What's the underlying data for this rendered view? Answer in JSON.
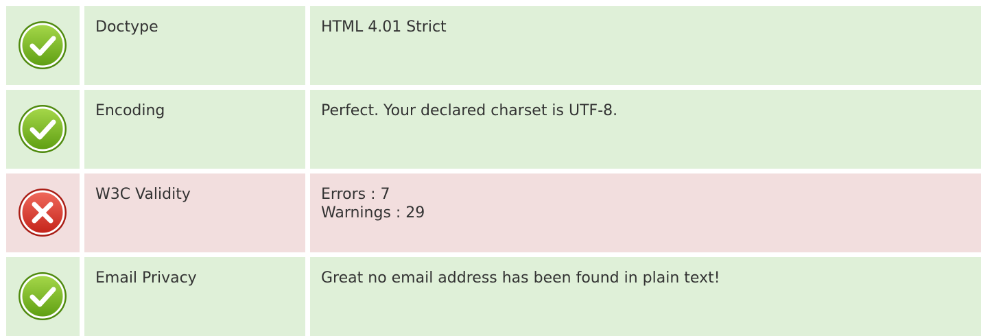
{
  "colors": {
    "pass_bg": "#dff0d8",
    "fail_bg": "#f2dede",
    "pass_icon": "#7ab51d",
    "fail_icon": "#d9342b"
  },
  "rows": [
    {
      "status": "pass",
      "icon": "check-icon",
      "label": "Doctype",
      "value": [
        "HTML 4.01 Strict"
      ]
    },
    {
      "status": "pass",
      "icon": "check-icon",
      "label": "Encoding",
      "value": [
        "Perfect. Your declared charset is UTF-8."
      ]
    },
    {
      "status": "fail",
      "icon": "cross-icon",
      "label": "W3C Validity",
      "value": [
        "Errors : 7",
        "Warnings : 29"
      ]
    },
    {
      "status": "pass",
      "icon": "check-icon",
      "label": "Email Privacy",
      "value": [
        "Great no email address has been found in plain text!"
      ]
    }
  ]
}
